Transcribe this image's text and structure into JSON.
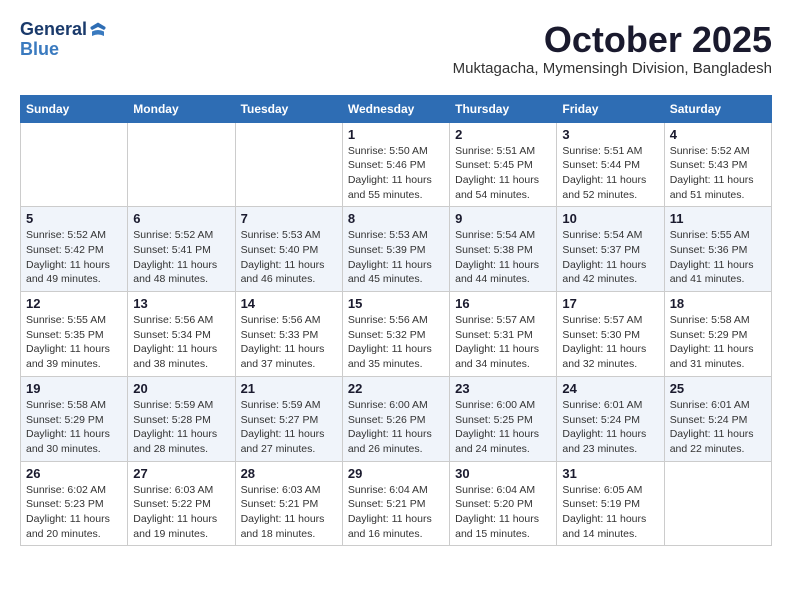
{
  "header": {
    "logo_line1": "General",
    "logo_line2": "Blue",
    "month_title": "October 2025",
    "location": "Muktagacha, Mymensingh Division, Bangladesh"
  },
  "weekdays": [
    "Sunday",
    "Monday",
    "Tuesday",
    "Wednesday",
    "Thursday",
    "Friday",
    "Saturday"
  ],
  "weeks": [
    [
      {
        "day": "",
        "info": ""
      },
      {
        "day": "",
        "info": ""
      },
      {
        "day": "",
        "info": ""
      },
      {
        "day": "1",
        "info": "Sunrise: 5:50 AM\nSunset: 5:46 PM\nDaylight: 11 hours and 55 minutes."
      },
      {
        "day": "2",
        "info": "Sunrise: 5:51 AM\nSunset: 5:45 PM\nDaylight: 11 hours and 54 minutes."
      },
      {
        "day": "3",
        "info": "Sunrise: 5:51 AM\nSunset: 5:44 PM\nDaylight: 11 hours and 52 minutes."
      },
      {
        "day": "4",
        "info": "Sunrise: 5:52 AM\nSunset: 5:43 PM\nDaylight: 11 hours and 51 minutes."
      }
    ],
    [
      {
        "day": "5",
        "info": "Sunrise: 5:52 AM\nSunset: 5:42 PM\nDaylight: 11 hours and 49 minutes."
      },
      {
        "day": "6",
        "info": "Sunrise: 5:52 AM\nSunset: 5:41 PM\nDaylight: 11 hours and 48 minutes."
      },
      {
        "day": "7",
        "info": "Sunrise: 5:53 AM\nSunset: 5:40 PM\nDaylight: 11 hours and 46 minutes."
      },
      {
        "day": "8",
        "info": "Sunrise: 5:53 AM\nSunset: 5:39 PM\nDaylight: 11 hours and 45 minutes."
      },
      {
        "day": "9",
        "info": "Sunrise: 5:54 AM\nSunset: 5:38 PM\nDaylight: 11 hours and 44 minutes."
      },
      {
        "day": "10",
        "info": "Sunrise: 5:54 AM\nSunset: 5:37 PM\nDaylight: 11 hours and 42 minutes."
      },
      {
        "day": "11",
        "info": "Sunrise: 5:55 AM\nSunset: 5:36 PM\nDaylight: 11 hours and 41 minutes."
      }
    ],
    [
      {
        "day": "12",
        "info": "Sunrise: 5:55 AM\nSunset: 5:35 PM\nDaylight: 11 hours and 39 minutes."
      },
      {
        "day": "13",
        "info": "Sunrise: 5:56 AM\nSunset: 5:34 PM\nDaylight: 11 hours and 38 minutes."
      },
      {
        "day": "14",
        "info": "Sunrise: 5:56 AM\nSunset: 5:33 PM\nDaylight: 11 hours and 37 minutes."
      },
      {
        "day": "15",
        "info": "Sunrise: 5:56 AM\nSunset: 5:32 PM\nDaylight: 11 hours and 35 minutes."
      },
      {
        "day": "16",
        "info": "Sunrise: 5:57 AM\nSunset: 5:31 PM\nDaylight: 11 hours and 34 minutes."
      },
      {
        "day": "17",
        "info": "Sunrise: 5:57 AM\nSunset: 5:30 PM\nDaylight: 11 hours and 32 minutes."
      },
      {
        "day": "18",
        "info": "Sunrise: 5:58 AM\nSunset: 5:29 PM\nDaylight: 11 hours and 31 minutes."
      }
    ],
    [
      {
        "day": "19",
        "info": "Sunrise: 5:58 AM\nSunset: 5:29 PM\nDaylight: 11 hours and 30 minutes."
      },
      {
        "day": "20",
        "info": "Sunrise: 5:59 AM\nSunset: 5:28 PM\nDaylight: 11 hours and 28 minutes."
      },
      {
        "day": "21",
        "info": "Sunrise: 5:59 AM\nSunset: 5:27 PM\nDaylight: 11 hours and 27 minutes."
      },
      {
        "day": "22",
        "info": "Sunrise: 6:00 AM\nSunset: 5:26 PM\nDaylight: 11 hours and 26 minutes."
      },
      {
        "day": "23",
        "info": "Sunrise: 6:00 AM\nSunset: 5:25 PM\nDaylight: 11 hours and 24 minutes."
      },
      {
        "day": "24",
        "info": "Sunrise: 6:01 AM\nSunset: 5:24 PM\nDaylight: 11 hours and 23 minutes."
      },
      {
        "day": "25",
        "info": "Sunrise: 6:01 AM\nSunset: 5:24 PM\nDaylight: 11 hours and 22 minutes."
      }
    ],
    [
      {
        "day": "26",
        "info": "Sunrise: 6:02 AM\nSunset: 5:23 PM\nDaylight: 11 hours and 20 minutes."
      },
      {
        "day": "27",
        "info": "Sunrise: 6:03 AM\nSunset: 5:22 PM\nDaylight: 11 hours and 19 minutes."
      },
      {
        "day": "28",
        "info": "Sunrise: 6:03 AM\nSunset: 5:21 PM\nDaylight: 11 hours and 18 minutes."
      },
      {
        "day": "29",
        "info": "Sunrise: 6:04 AM\nSunset: 5:21 PM\nDaylight: 11 hours and 16 minutes."
      },
      {
        "day": "30",
        "info": "Sunrise: 6:04 AM\nSunset: 5:20 PM\nDaylight: 11 hours and 15 minutes."
      },
      {
        "day": "31",
        "info": "Sunrise: 6:05 AM\nSunset: 5:19 PM\nDaylight: 11 hours and 14 minutes."
      },
      {
        "day": "",
        "info": ""
      }
    ]
  ]
}
